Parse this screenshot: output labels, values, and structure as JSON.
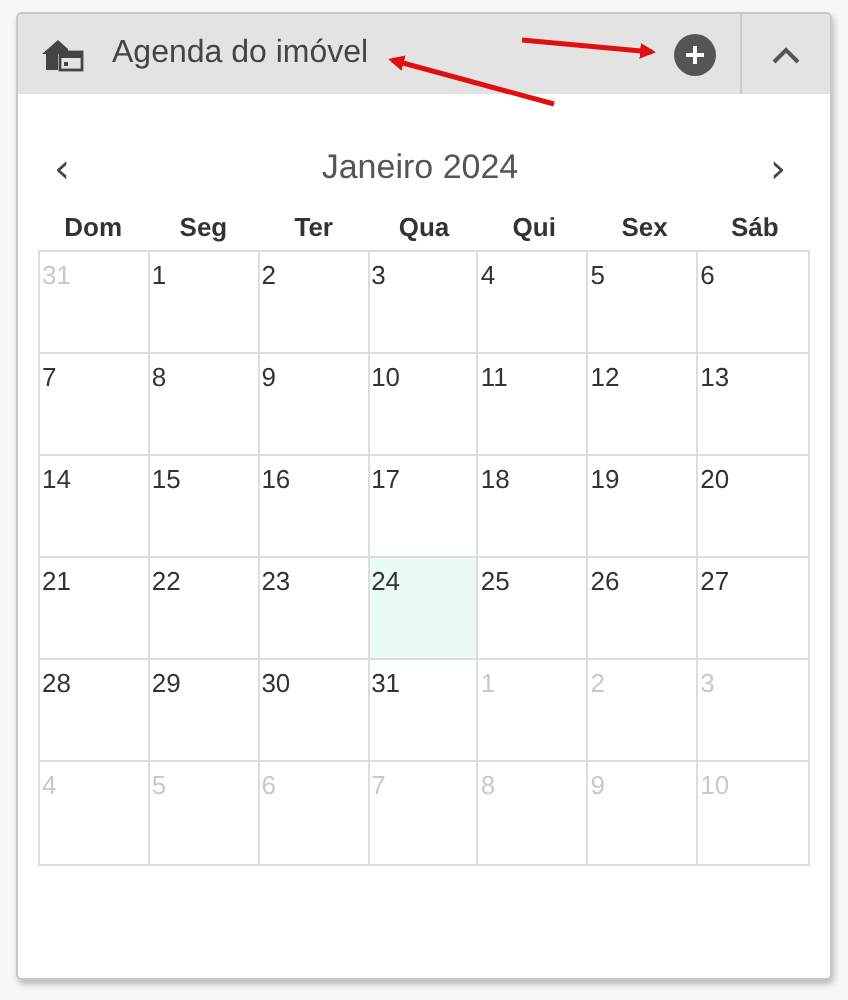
{
  "panel": {
    "title": "Agenda do imóvel",
    "expanded": true
  },
  "calendar": {
    "month": "Janeiro 2024",
    "prev": "‹",
    "next": "›",
    "weekdays": [
      "Dom",
      "Seg",
      "Ter",
      "Qua",
      "Qui",
      "Sex",
      "Sáb"
    ],
    "weeks": [
      [
        {
          "day": "31",
          "outside": true,
          "today": false
        },
        {
          "day": "1",
          "outside": false,
          "today": false
        },
        {
          "day": "2",
          "outside": false,
          "today": false
        },
        {
          "day": "3",
          "outside": false,
          "today": false
        },
        {
          "day": "4",
          "outside": false,
          "today": false
        },
        {
          "day": "5",
          "outside": false,
          "today": false
        },
        {
          "day": "6",
          "outside": false,
          "today": false
        }
      ],
      [
        {
          "day": "7",
          "outside": false,
          "today": false
        },
        {
          "day": "8",
          "outside": false,
          "today": false
        },
        {
          "day": "9",
          "outside": false,
          "today": false
        },
        {
          "day": "10",
          "outside": false,
          "today": false
        },
        {
          "day": "11",
          "outside": false,
          "today": false
        },
        {
          "day": "12",
          "outside": false,
          "today": false
        },
        {
          "day": "13",
          "outside": false,
          "today": false
        }
      ],
      [
        {
          "day": "14",
          "outside": false,
          "today": false
        },
        {
          "day": "15",
          "outside": false,
          "today": false
        },
        {
          "day": "16",
          "outside": false,
          "today": false
        },
        {
          "day": "17",
          "outside": false,
          "today": false
        },
        {
          "day": "18",
          "outside": false,
          "today": false
        },
        {
          "day": "19",
          "outside": false,
          "today": false
        },
        {
          "day": "20",
          "outside": false,
          "today": false
        }
      ],
      [
        {
          "day": "21",
          "outside": false,
          "today": false
        },
        {
          "day": "22",
          "outside": false,
          "today": false
        },
        {
          "day": "23",
          "outside": false,
          "today": false
        },
        {
          "day": "24",
          "outside": false,
          "today": true
        },
        {
          "day": "25",
          "outside": false,
          "today": false
        },
        {
          "day": "26",
          "outside": false,
          "today": false
        },
        {
          "day": "27",
          "outside": false,
          "today": false
        }
      ],
      [
        {
          "day": "28",
          "outside": false,
          "today": false
        },
        {
          "day": "29",
          "outside": false,
          "today": false
        },
        {
          "day": "30",
          "outside": false,
          "today": false
        },
        {
          "day": "31",
          "outside": false,
          "today": false
        },
        {
          "day": "1",
          "outside": true,
          "today": false
        },
        {
          "day": "2",
          "outside": true,
          "today": false
        },
        {
          "day": "3",
          "outside": true,
          "today": false
        }
      ],
      [
        {
          "day": "4",
          "outside": true,
          "today": false
        },
        {
          "day": "5",
          "outside": true,
          "today": false
        },
        {
          "day": "6",
          "outside": true,
          "today": false
        },
        {
          "day": "7",
          "outside": true,
          "today": false
        },
        {
          "day": "8",
          "outside": true,
          "today": false
        },
        {
          "day": "9",
          "outside": true,
          "today": false
        },
        {
          "day": "10",
          "outside": true,
          "today": false
        }
      ]
    ]
  }
}
